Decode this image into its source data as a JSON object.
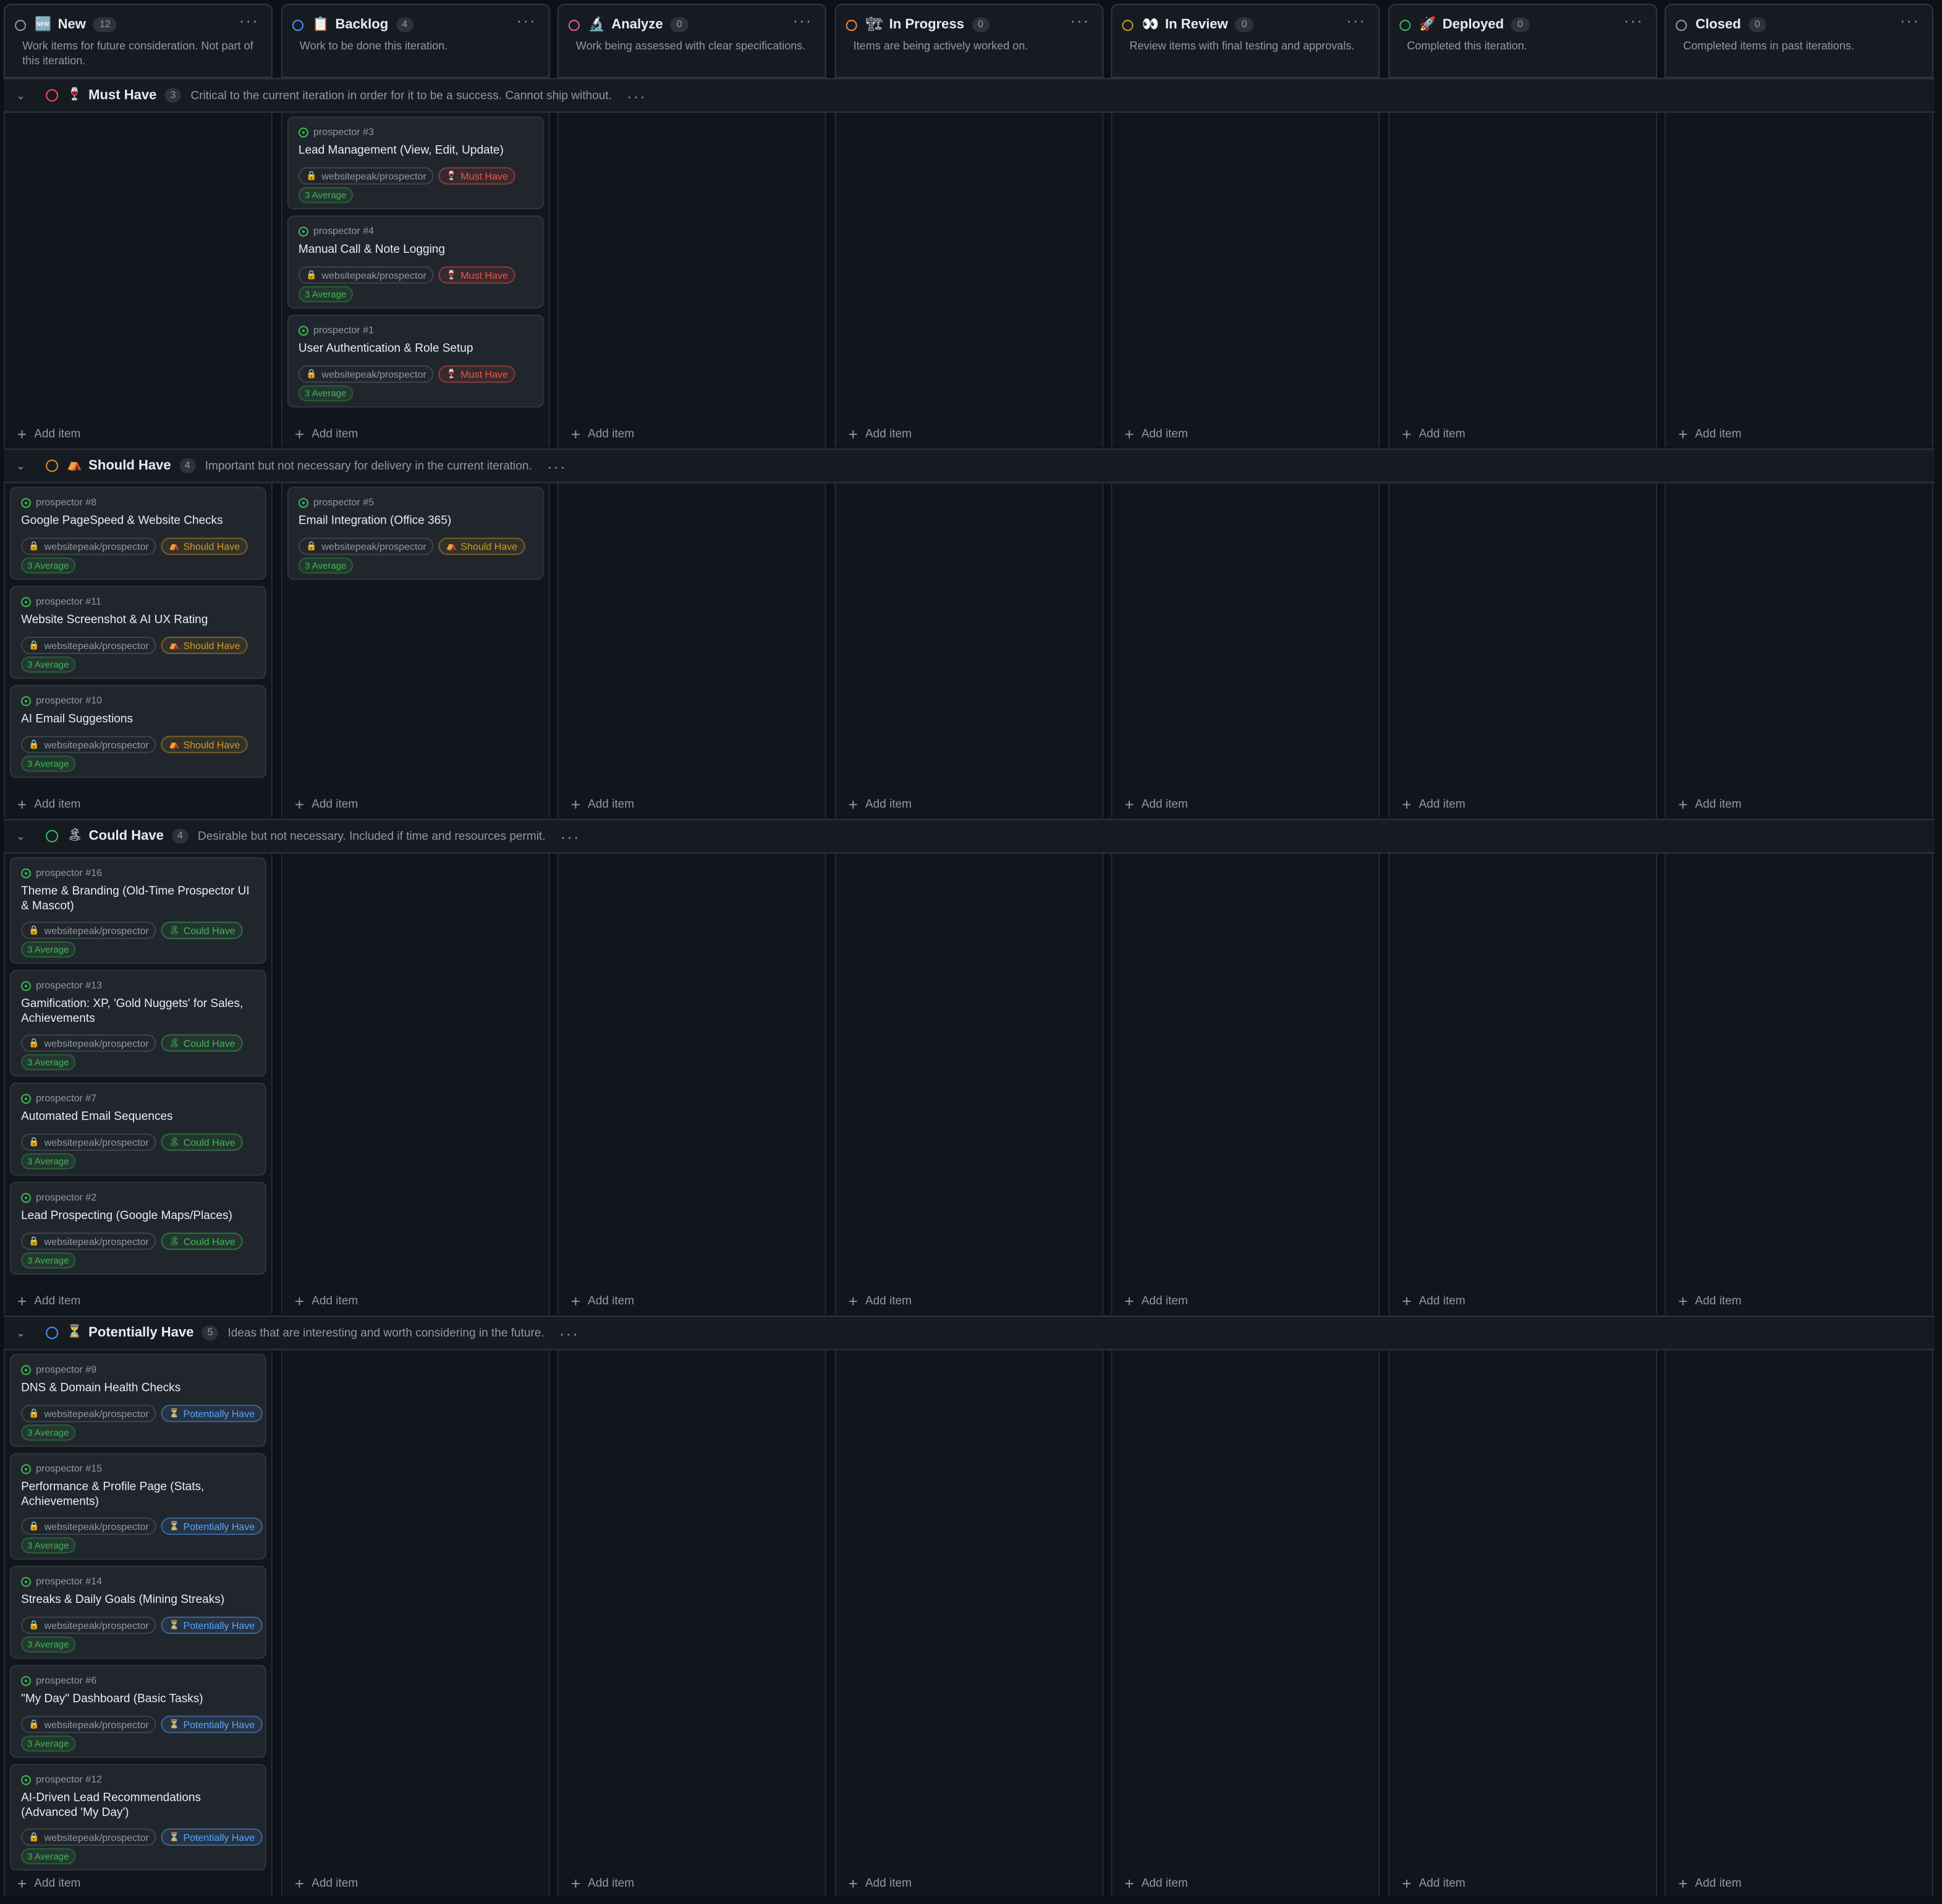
{
  "columns": [
    {
      "name": "New",
      "emoji": "🆕",
      "count": "12",
      "description": "Work items for future consideration. Not part of this iteration.",
      "ring_color": "#9198a1"
    },
    {
      "name": "Backlog",
      "emoji": "📋",
      "count": "4",
      "description": "Work to be done this iteration.",
      "ring_color": "#4493f8"
    },
    {
      "name": "Analyze",
      "emoji": "🔬",
      "count": "0",
      "description": "Work being assessed with clear specifications.",
      "ring_color": "#db61a2"
    },
    {
      "name": "In Progress",
      "emoji": "🏗",
      "count": "0",
      "description": "Items are being actively worked on.",
      "ring_color": "#f0883e"
    },
    {
      "name": "In Review",
      "emoji": "👀",
      "count": "0",
      "description": "Review items with final testing and approvals.",
      "ring_color": "#d29922"
    },
    {
      "name": "Deployed",
      "emoji": "🚀",
      "count": "0",
      "description": "Completed this iteration.",
      "ring_color": "#3fb950"
    },
    {
      "name": "Closed",
      "emoji": "",
      "count": "0",
      "description": "Completed items in past iterations.",
      "ring_color": "#9198a1"
    }
  ],
  "add_item_label": "Add item",
  "repo_label": "websitepeak/prospector",
  "estimate_label": "3 Average",
  "groups": [
    {
      "name": "Must Have",
      "emoji": "🍷",
      "count": "3",
      "description": "Critical to the current iteration in order for it to be a success. Cannot ship without.",
      "ring_color": "#f85149",
      "pill_class": "p-must",
      "pill_label": "Must Have",
      "pill_emoji": "🍷",
      "cells": [
        [],
        [
          {
            "ref": "prospector #3",
            "title": "Lead Management (View, Edit, Update)"
          },
          {
            "ref": "prospector #4",
            "title": "Manual Call & Note Logging"
          },
          {
            "ref": "prospector #1",
            "title": "User Authentication & Role Setup"
          }
        ],
        [],
        [],
        [],
        [],
        []
      ]
    },
    {
      "name": "Should Have",
      "emoji": "⛺",
      "count": "4",
      "description": "Important but not necessary for delivery in the current iteration.",
      "ring_color": "#d29922",
      "pill_class": "p-should",
      "pill_label": "Should Have",
      "pill_emoji": "⛺",
      "cells": [
        [
          {
            "ref": "prospector #8",
            "title": "Google PageSpeed & Website Checks"
          },
          {
            "ref": "prospector #11",
            "title": "Website Screenshot & AI UX Rating"
          },
          {
            "ref": "prospector #10",
            "title": "AI Email Suggestions"
          }
        ],
        [
          {
            "ref": "prospector #5",
            "title": "Email Integration (Office 365)"
          }
        ],
        [],
        [],
        [],
        [],
        []
      ]
    },
    {
      "name": "Could Have",
      "emoji": "🏝",
      "count": "4",
      "description": "Desirable but not necessary. Included if time and resources permit.",
      "ring_color": "#3fb950",
      "pill_class": "p-could",
      "pill_label": "Could Have",
      "pill_emoji": "🏝",
      "cells": [
        [
          {
            "ref": "prospector #16",
            "title": "Theme & Branding (Old-Time Prospector UI & Mascot)"
          },
          {
            "ref": "prospector #13",
            "title": "Gamification: XP, 'Gold Nuggets' for Sales, Achievements"
          },
          {
            "ref": "prospector #7",
            "title": "Automated Email Sequences"
          },
          {
            "ref": "prospector #2",
            "title": "Lead Prospecting (Google Maps/Places)"
          }
        ],
        [],
        [],
        [],
        [],
        [],
        []
      ]
    },
    {
      "name": "Potentially Have",
      "emoji": "⏳",
      "count": "5",
      "description": "Ideas that are interesting and worth considering in the future.",
      "ring_color": "#4493f8",
      "pill_class": "p-potential",
      "pill_label": "Potentially Have",
      "pill_emoji": "⏳",
      "cells": [
        [
          {
            "ref": "prospector #9",
            "title": "DNS & Domain Health Checks"
          },
          {
            "ref": "prospector #15",
            "title": "Performance & Profile Page (Stats, Achievements)"
          },
          {
            "ref": "prospector #14",
            "title": "Streaks & Daily Goals (Mining Streaks)"
          },
          {
            "ref": "prospector #6",
            "title": "\"My Day\" Dashboard (Basic Tasks)"
          },
          {
            "ref": "prospector #12",
            "title": "AI-Driven Lead Recommendations (Advanced 'My Day')"
          }
        ],
        [],
        [],
        [],
        [],
        [],
        []
      ]
    }
  ]
}
